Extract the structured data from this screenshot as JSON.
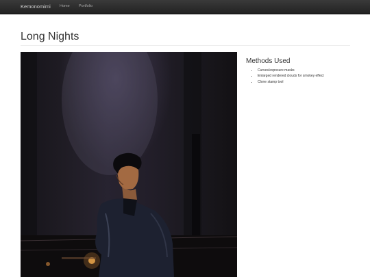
{
  "navbar": {
    "brand": "Kemonomimi",
    "links": [
      "Home",
      "Portfolio"
    ]
  },
  "page": {
    "title": "Long Nights"
  },
  "sidebar": {
    "heading": "Methods Used",
    "methods": [
      "Curves/exposure masks",
      "Enlarged rendered clouds for smokey effect",
      "Clone stamp tool"
    ]
  },
  "photo": {
    "description_icon": "portrait-photo-image"
  }
}
